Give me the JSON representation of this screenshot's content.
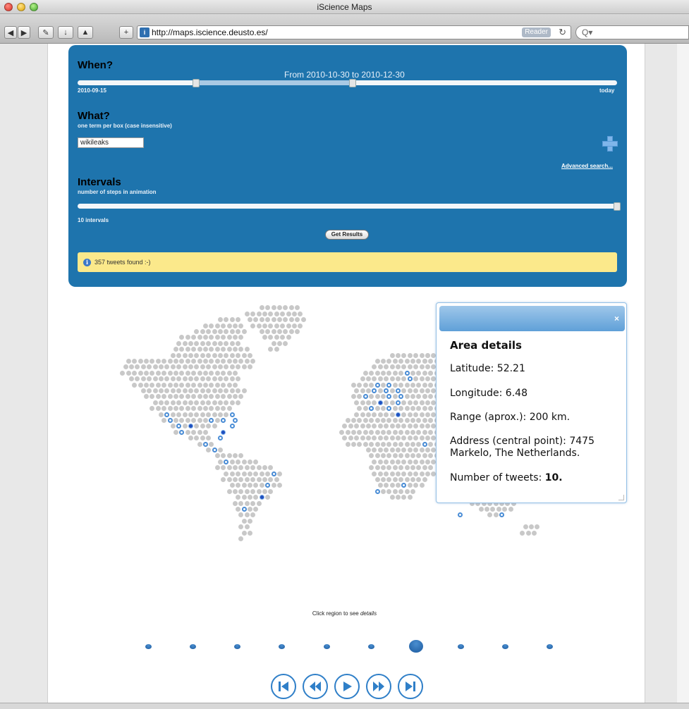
{
  "window": {
    "title": "iScience Maps"
  },
  "browser": {
    "url": "http://maps.iscience.deusto.es/",
    "reader_label": "Reader",
    "search_placeholder": "Q▾",
    "favicon_glyph": "i"
  },
  "when": {
    "heading": "When?",
    "range_text": "From 2010-10-30 to 2010-12-30",
    "start_label": "2010-09-15",
    "end_label": "today",
    "range_start_fraction": 0.22,
    "range_end_fraction": 0.51
  },
  "what": {
    "heading": "What?",
    "subtitle": "one term per box (case insensitive)",
    "term_value": "wikileaks",
    "advanced_link": "Advanced search..."
  },
  "intervals": {
    "heading": "Intervals",
    "subtitle": "number of steps in animation",
    "value_label": "10 intervals",
    "value": 10
  },
  "get_results_label": "Get Results",
  "notice": {
    "icon": "info-icon",
    "text": "357 tweets found :-)"
  },
  "popup": {
    "title": "Area details",
    "latitude_label": "Latitude: 52.21",
    "longitude_label": "Longitude: 6.48",
    "range_label": "Range (aprox.): 200 km.",
    "address_label": "Address (central point): 7475 Markelo, The Netherlands.",
    "tweets_prefix": "Number of tweets: ",
    "tweets_value": "10."
  },
  "caption_prefix": "Click region to see ",
  "caption_em": "details",
  "animation": {
    "steps": 10,
    "active_step": 7
  },
  "controls": [
    "first-icon",
    "rewind-icon",
    "play-icon",
    "fast-forward-icon",
    "last-icon"
  ],
  "colors": {
    "panel": "#1e74ad",
    "notice": "#fbe98b",
    "accent": "#2f7fc8"
  }
}
